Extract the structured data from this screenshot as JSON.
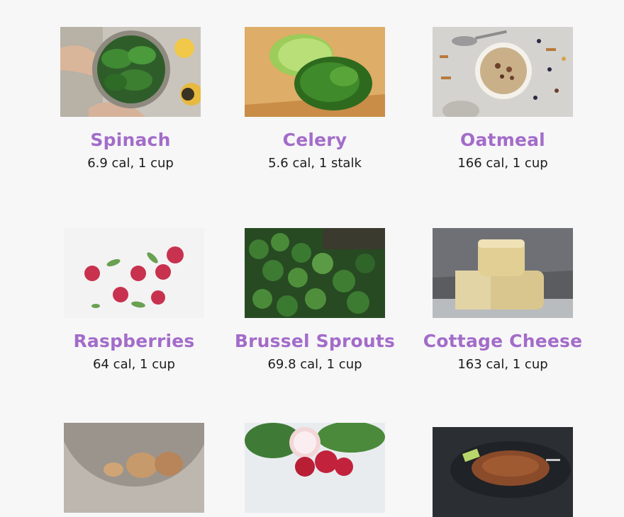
{
  "foods": [
    {
      "name": "Spinach",
      "cal": "6.9 cal, 1 cup",
      "image": "spinach-bowl-photo"
    },
    {
      "name": "Celery",
      "cal": "5.6 cal, 1 stalk",
      "image": "chopped-celery-photo"
    },
    {
      "name": "Oatmeal",
      "cal": "166 cal, 1 cup",
      "image": "oatmeal-bowl-photo"
    },
    {
      "name": "Raspberries",
      "cal": "64 cal, 1 cup",
      "image": "raspberries-photo"
    },
    {
      "name": "Brussel Sprouts",
      "cal": "69.8 cal, 1 cup",
      "image": "brussel-sprouts-photo"
    },
    {
      "name": "Cottage Cheese",
      "cal": "163 cal, 1 cup",
      "image": "cheese-wheels-photo"
    },
    {
      "image": "eggs-photo"
    },
    {
      "image": "radishes-photo"
    },
    {
      "image": "grilled-dish-photo"
    }
  ],
  "colors": {
    "name": "#a36cc9",
    "text": "#1c1c1c",
    "background": "#f7f7f8"
  }
}
